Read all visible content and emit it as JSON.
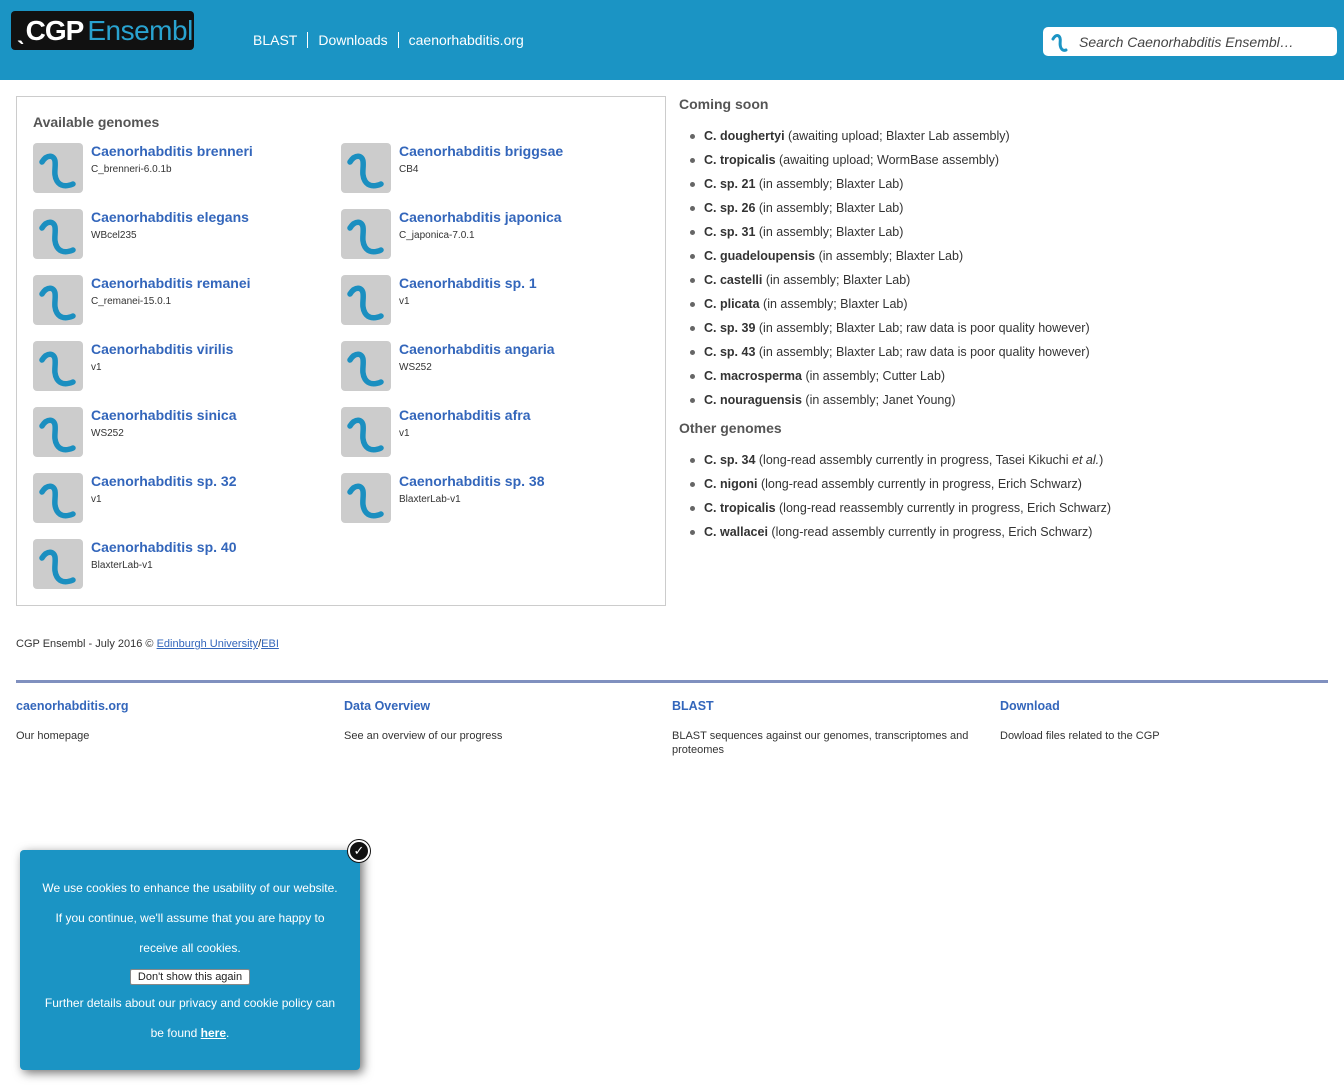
{
  "header": {
    "logo_mark": "ˎ",
    "logo_cgp": "CGP",
    "logo_ensembl": "Ensembl",
    "nav": [
      "BLAST",
      "Downloads",
      "caenorhabditis.org"
    ],
    "search_placeholder": "Search Caenorhabditis Ensembl…",
    "background_color": "#1b94c4"
  },
  "genomes": {
    "title": "Available genomes",
    "icon": "worm-icon",
    "items": [
      {
        "name": "Caenorhabditis brenneri",
        "version": "C_brenneri-6.0.1b"
      },
      {
        "name": "Caenorhabditis briggsae",
        "version": "CB4"
      },
      {
        "name": "Caenorhabditis elegans",
        "version": "WBcel235"
      },
      {
        "name": "Caenorhabditis japonica",
        "version": "C_japonica-7.0.1"
      },
      {
        "name": "Caenorhabditis remanei",
        "version": "C_remanei-15.0.1"
      },
      {
        "name": "Caenorhabditis sp. 1",
        "version": "v1"
      },
      {
        "name": "Caenorhabditis virilis",
        "version": "v1"
      },
      {
        "name": "Caenorhabditis angaria",
        "version": "WS252"
      },
      {
        "name": "Caenorhabditis sinica",
        "version": "WS252"
      },
      {
        "name": "Caenorhabditis afra",
        "version": "v1"
      },
      {
        "name": "Caenorhabditis sp. 32",
        "version": "v1"
      },
      {
        "name": "Caenorhabditis sp. 38",
        "version": "BlaxterLab-v1"
      },
      {
        "name": "Caenorhabditis sp. 40",
        "version": "BlaxterLab-v1"
      }
    ]
  },
  "coming_soon": {
    "title": "Coming soon",
    "items": [
      {
        "species": "C. doughertyi",
        "note": " (awaiting upload; Blaxter Lab assembly)"
      },
      {
        "species": "C. tropicalis",
        "note": " (awaiting upload; WormBase assembly)"
      },
      {
        "species": "C. sp. 21",
        "note": " (in assembly; Blaxter Lab)"
      },
      {
        "species": "C. sp. 26",
        "note": " (in assembly; Blaxter Lab)"
      },
      {
        "species": "C. sp. 31",
        "note": " (in assembly; Blaxter Lab)"
      },
      {
        "species": "C. guadeloupensis",
        "note": " (in assembly; Blaxter Lab)"
      },
      {
        "species": "C. castelli",
        "note": " (in assembly; Blaxter Lab)"
      },
      {
        "species": "C. plicata",
        "note": " (in assembly; Blaxter Lab)"
      },
      {
        "species": "C. sp. 39",
        "note": " (in assembly; Blaxter Lab; raw data is poor quality however)"
      },
      {
        "species": "C. sp. 43",
        "note": " (in assembly; Blaxter Lab; raw data is poor quality however)"
      },
      {
        "species": "C. macrosperma",
        "note": " (in assembly; Cutter Lab)"
      },
      {
        "species": "C. nouraguensis",
        "note": " (in assembly; Janet Young)"
      }
    ]
  },
  "other_genomes": {
    "title": "Other genomes",
    "items": [
      {
        "species": "C. sp. 34",
        "note": " (long-read assembly currently in progress, Tasei Kikuchi ",
        "note_italic": "et al.",
        "note_end": ")"
      },
      {
        "species": "C. nigoni",
        "note": " (long-read assembly currently in progress, Erich Schwarz)"
      },
      {
        "species": "C. tropicalis",
        "note": " (long-read reassembly currently in progress, Erich Schwarz)"
      },
      {
        "species": "C. wallacei",
        "note": " (long-read assembly currently in progress, Erich Schwarz)"
      }
    ]
  },
  "copyright": {
    "text": "CGP Ensembl - July 2016 © ",
    "link1": "Edinburgh University",
    "sep": "/",
    "link2": "EBI"
  },
  "footer": [
    {
      "title": "caenorhabditis.org",
      "desc": "Our homepage"
    },
    {
      "title": "Data Overview",
      "desc": "See an overview of our progress"
    },
    {
      "title": "BLAST",
      "desc": "BLAST sequences against our genomes, transcriptomes and proteomes"
    },
    {
      "title": "Download",
      "desc": "Dowload files related to the CGP"
    }
  ],
  "cookie": {
    "text": "We use cookies to enhance the usability of our website. If you continue, we'll assume that you are happy to receive all cookies.",
    "button": "Don't show this again",
    "policy_text": "Further details about our privacy and cookie policy can be found ",
    "policy_link": "here",
    "policy_end": ".",
    "close_glyph": "✓"
  }
}
